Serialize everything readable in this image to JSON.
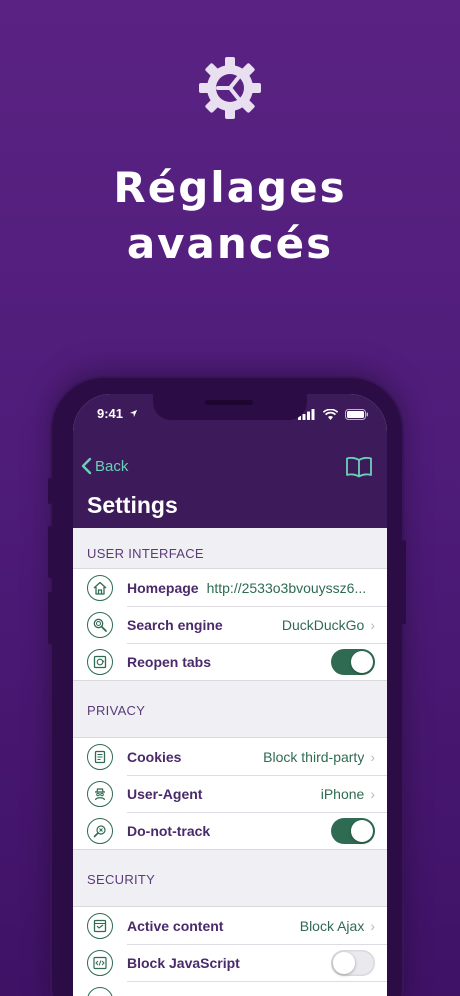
{
  "hero": {
    "title_line1": "Réglages",
    "title_line2": "avancés",
    "icon": "gear-icon"
  },
  "status_bar": {
    "time": "9:41"
  },
  "nav": {
    "back_label": "Back",
    "title": "Settings",
    "right_icon": "bookmarks-icon"
  },
  "colors": {
    "background": "#4f1c7a",
    "nav_bar": "#3d1a5a",
    "accent": "#2f6b52",
    "back_tint": "#6ad0b8",
    "label": "#4a2a6a"
  },
  "sections": [
    {
      "header": "USER INTERFACE",
      "rows": [
        {
          "label": "Homepage",
          "value": "http://2533o3bvouyssz6...",
          "icon": "home-icon"
        },
        {
          "label": "Search engine",
          "value": "DuckDuckGo",
          "icon": "search-icon"
        },
        {
          "label": "Reopen tabs",
          "toggle": true,
          "icon": "tabs-icon"
        }
      ]
    },
    {
      "header": "PRIVACY",
      "rows": [
        {
          "label": "Cookies",
          "value": "Block third-party",
          "icon": "cookie-icon"
        },
        {
          "label": "User-Agent",
          "value": "iPhone",
          "icon": "agent-icon"
        },
        {
          "label": "Do-not-track",
          "toggle": true,
          "icon": "do-not-track-icon"
        }
      ]
    },
    {
      "header": "SECURITY",
      "rows": [
        {
          "label": "Active content",
          "value": "Block Ajax",
          "icon": "active-content-icon"
        },
        {
          "label": "Block JavaScript",
          "toggle": false,
          "icon": "javascript-icon"
        }
      ]
    }
  ]
}
